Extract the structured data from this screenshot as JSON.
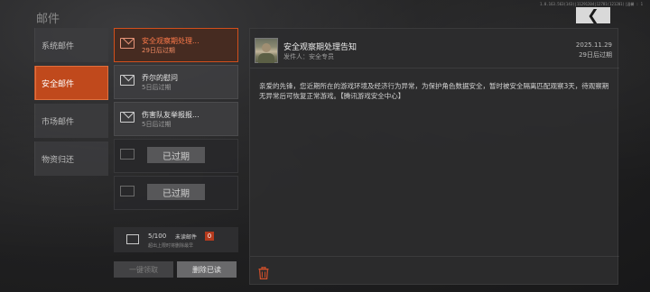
{
  "page_title": "邮件",
  "build_info": "1.0.163.563(143)|11291204|12781(121201)|温馨 : 1",
  "back_icon": "chevron-left-double-icon",
  "sidebar": {
    "items": [
      {
        "label": "系统邮件",
        "active": false
      },
      {
        "label": "安全邮件",
        "active": true
      },
      {
        "label": "市场邮件",
        "active": false
      },
      {
        "label": "物资归还",
        "active": false
      }
    ]
  },
  "mail_list": [
    {
      "title": "安全观察期处理...",
      "sub": "29日后过期",
      "state": "active"
    },
    {
      "title": "乔尔的慰问",
      "sub": "5日后过期",
      "state": "normal"
    },
    {
      "title": "伤害队友举报报...",
      "sub": "5日后过期",
      "state": "normal"
    },
    {
      "overlay": "已过期",
      "state": "expired"
    },
    {
      "overlay": "已过期",
      "state": "expired"
    }
  ],
  "list_footer": {
    "count": "5/100",
    "unread_label": "未读邮件",
    "unread_count": "0",
    "limit_note": "超出上限时将删除最早"
  },
  "buttons": {
    "claim_all": "一键领取",
    "delete_read": "删除已读"
  },
  "detail": {
    "title": "安全观察期处理告知",
    "sender": "发件人：安全专员",
    "date": "2025.11.29",
    "expiry": "29日后过期",
    "body": "亲爱的先锋，您近期所在的游戏环境及经济行为异常，为保护角色数据安全，暂时被安全隔离匹配观察3天，待观察期无异常后可恢复正常游戏。【腾讯游戏安全中心】"
  },
  "colors": {
    "accent": "#c0491c",
    "active_text": "#ff7a4a",
    "badge": "#b53a1d",
    "trash": "#d4502a"
  }
}
